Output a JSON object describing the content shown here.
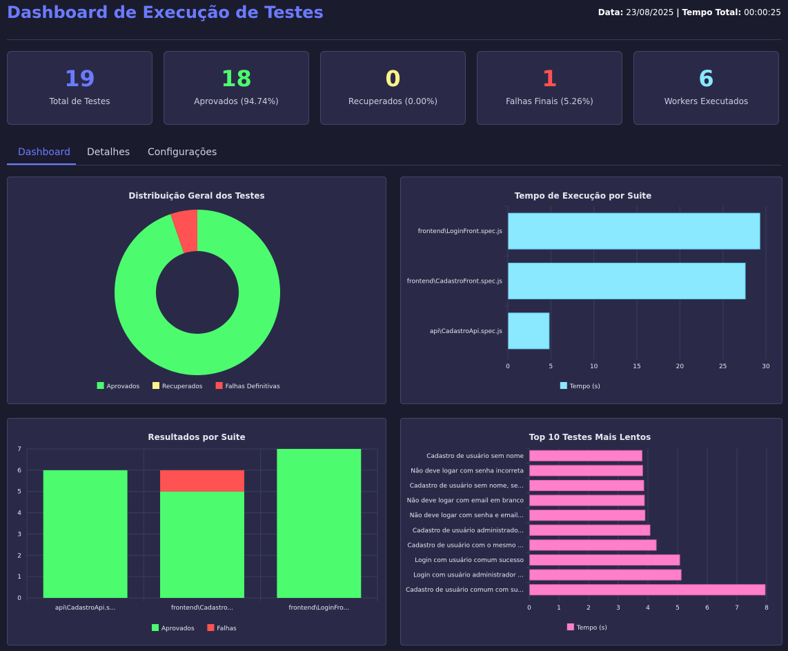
{
  "header": {
    "title": "Dashboard de Execução de Testes",
    "date_label": "Data:",
    "date_value": "23/08/2025",
    "separator": "|",
    "total_time_label": "Tempo Total:",
    "total_time_value": "00:00:25"
  },
  "cards": [
    {
      "value": "19",
      "label": "Total de Testes",
      "color": "#6b7bff"
    },
    {
      "value": "18",
      "label": "Aprovados (94.74%)",
      "color": "#4cfc6e"
    },
    {
      "value": "0",
      "label": "Recuperados (0.00%)",
      "color": "#fcf38a"
    },
    {
      "value": "1",
      "label": "Falhas Finais (5.26%)",
      "color": "#ff5252"
    },
    {
      "value": "6",
      "label": "Workers Executados",
      "color": "#8ae8ff"
    }
  ],
  "tabs": [
    {
      "label": "Dashboard",
      "active": true
    },
    {
      "label": "Detalhes",
      "active": false
    },
    {
      "label": "Configurações",
      "active": false
    }
  ],
  "colors": {
    "approved": "#4cfc6e",
    "recovered": "#fcf38a",
    "failed": "#ff5252",
    "time_suite": "#8ae8ff",
    "time_tests": "#ff7fcb"
  },
  "chart_data": [
    {
      "type": "pie",
      "title": "Distribuição Geral dos Testes",
      "categories": [
        "Aprovados",
        "Recuperados",
        "Falhas Definitivas"
      ],
      "values": [
        18,
        0,
        1
      ],
      "legend": "bottom"
    },
    {
      "type": "bar",
      "orientation": "horizontal",
      "title": "Tempo de Execução por Suite",
      "categories": [
        "frontend\\LoginFront.spec.js",
        "frontend\\CadastroFront.spec.js",
        "api\\CadastroApi.spec.js"
      ],
      "series": [
        {
          "name": "Tempo (s)",
          "values": [
            29.3,
            27.6,
            4.8
          ]
        }
      ],
      "xlim": [
        0,
        30
      ],
      "xticks": [
        "0",
        "5",
        "10",
        "15",
        "20",
        "25",
        "30"
      ],
      "grid": true,
      "legend": "bottom"
    },
    {
      "type": "bar",
      "stacked": true,
      "title": "Resultados por Suite",
      "categories": [
        "api\\CadastroApi.s...",
        "frontend\\Cadastro...",
        "frontend\\LoginFro..."
      ],
      "series": [
        {
          "name": "Aprovados",
          "values": [
            6,
            5,
            7
          ]
        },
        {
          "name": "Falhas",
          "values": [
            0,
            1,
            0
          ]
        }
      ],
      "ylim": [
        0,
        7
      ],
      "yticks": [
        "0",
        "1",
        "2",
        "3",
        "4",
        "5",
        "6",
        "7"
      ],
      "grid": true,
      "legend": "bottom"
    },
    {
      "type": "bar",
      "orientation": "horizontal",
      "title": "Top 10 Testes Mais Lentos",
      "categories": [
        "Cadastro de usuário sem nome",
        "Não deve logar com senha incorreta",
        "Cadastro de usuário sem nome, se...",
        "Não deve logar com email em branco",
        "Não deve logar com senha e email...",
        "Cadastro de usuário administrado...",
        "Cadastro de usuário com o mesmo ...",
        "Login com usuário comum sucesso",
        "Login com usuário administrador ...",
        "Cadastro de usuário comum com su..."
      ],
      "series": [
        {
          "name": "Tempo (s)",
          "values": [
            3.8,
            3.82,
            3.86,
            3.88,
            3.9,
            4.07,
            4.28,
            5.07,
            5.12,
            7.95
          ]
        }
      ],
      "xlim": [
        0,
        8
      ],
      "xticks": [
        "0",
        "1",
        "2",
        "3",
        "4",
        "5",
        "6",
        "7",
        "8"
      ],
      "grid": true,
      "legend": "bottom"
    }
  ]
}
